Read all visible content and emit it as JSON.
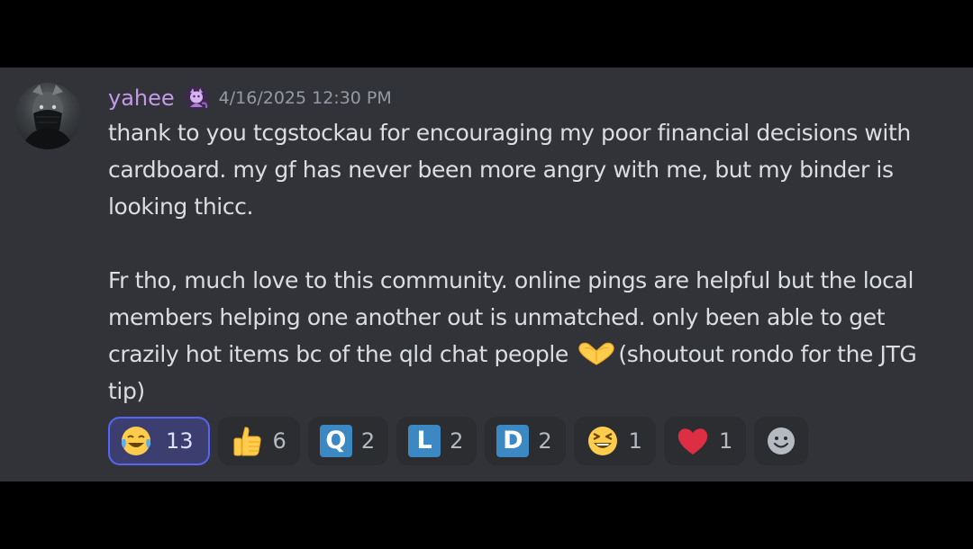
{
  "message": {
    "author": {
      "username": "yahee",
      "role_icon": "purple-mewtwo-role-icon",
      "name_color": "#c39ae8"
    },
    "timestamp": "4/16/2025 12:30 PM",
    "paragraph_1": "thank to you tcgstockau for encouraging my poor financial decisions with cardboard. my gf has never been more angry with me, but my binder is looking thicc.",
    "paragraph_2_before_emoji": "Fr tho, much love to this community. online pings are helpful but the local members helping one another out is unmatched. only been able to get crazily hot items bc of the qld chat people",
    "inline_emoji": "heart-hands-emoji",
    "paragraph_2_after_emoji": "(shoutout rondo for the JTG tip)"
  },
  "reactions": [
    {
      "emoji": "joy-emoji",
      "count": "13",
      "reacted_by_me": true
    },
    {
      "emoji": "thumbs-up-emoji",
      "count": "6",
      "reacted_by_me": false
    },
    {
      "emoji": "regional-indicator-q",
      "letter": "Q",
      "count": "2",
      "reacted_by_me": false
    },
    {
      "emoji": "regional-indicator-l",
      "letter": "L",
      "count": "2",
      "reacted_by_me": false
    },
    {
      "emoji": "regional-indicator-d",
      "letter": "D",
      "count": "2",
      "reacted_by_me": false
    },
    {
      "emoji": "laughing-emoji",
      "count": "1",
      "reacted_by_me": false
    },
    {
      "emoji": "red-heart-emoji",
      "count": "1",
      "reacted_by_me": false
    }
  ],
  "add_reaction_icon": "add-reaction-smiley-icon",
  "colors": {
    "background": "#313338",
    "text": "#dbdee1",
    "timestamp": "#949ba4",
    "reaction_bg": "#2b2d31",
    "reaction_me_border": "#5865f2"
  }
}
